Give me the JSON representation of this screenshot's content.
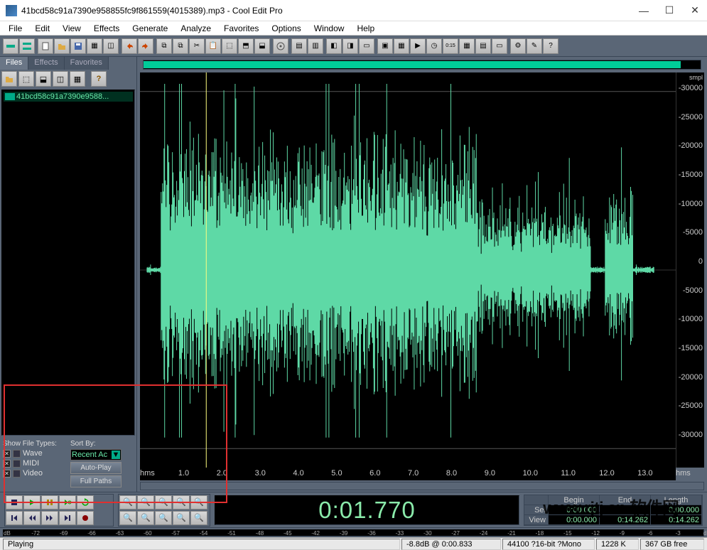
{
  "title": "41bcd58c91a7390e958855fc9f861559(4015389).mp3 - Cool Edit Pro",
  "menu": [
    "File",
    "Edit",
    "View",
    "Effects",
    "Generate",
    "Analyze",
    "Favorites",
    "Options",
    "Window",
    "Help"
  ],
  "tabs": [
    "Files",
    "Effects",
    "Favorites"
  ],
  "active_tab": 0,
  "file_list": [
    "41bcd58c91a7390e9588..."
  ],
  "file_options": {
    "show_label": "Show File Types:",
    "sort_label": "Sort By:",
    "types": [
      "Wave",
      "MIDI",
      "Video"
    ],
    "sort_value": "Recent Ac",
    "autoplay": "Auto-Play",
    "fullpaths": "Full Paths"
  },
  "amp_unit": "smpl",
  "amp_ticks": [
    "-30000",
    "-25000",
    "-20000",
    "-15000",
    "-10000",
    "-5000",
    "0",
    "-5000",
    "-10000",
    "-15000",
    "-20000",
    "-25000",
    "-30000"
  ],
  "time_unit": "hms",
  "time_ticks": [
    "hms",
    "1.0",
    "2.0",
    "3.0",
    "4.0",
    "5.0",
    "6.0",
    "7.0",
    "8.0",
    "9.0",
    "10.0",
    "11.0",
    "12.0",
    "13.0",
    "hms"
  ],
  "time_display": "0:01.770",
  "sel_grid": {
    "headers": [
      "",
      "Begin",
      "End",
      "Length"
    ],
    "rows": [
      {
        "label": "Sel",
        "begin": "0:00.000",
        "end": "",
        "length": "0:00.000"
      },
      {
        "label": "View",
        "begin": "0:00.000",
        "end": "0:14.262",
        "length": "0:14.262"
      }
    ]
  },
  "level_ticks": [
    "dB",
    "-72",
    "-69",
    "-66",
    "-63",
    "-60",
    "-57",
    "-54",
    "-51",
    "-48",
    "-45",
    "-42",
    "-39",
    "-36",
    "-33",
    "-30",
    "-27",
    "-24",
    "-21",
    "-18",
    "-15",
    "-12",
    "-9",
    "-6",
    "-3",
    "d"
  ],
  "status": {
    "state": "Playing",
    "db": "-8.8dB @ 0:00.833",
    "format": "44100 ?16-bit ?Mono",
    "mem": "1228 K",
    "disk": "367 GB free"
  },
  "watermark": "www.rjtj.cn 软件网"
}
